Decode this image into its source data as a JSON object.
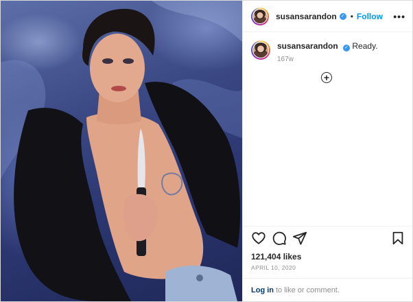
{
  "post": {
    "username": "susansarandon",
    "separator": "•",
    "follow_label": "Follow",
    "more_label": "•••",
    "caption": "Ready.",
    "caption_age": "167w",
    "likes": "121,404 likes",
    "date": "APRIL 10, 2020",
    "login_link": "Log in",
    "login_text": "to like or comment."
  },
  "icons": [
    "heart-icon",
    "comment-icon",
    "share-icon",
    "bookmark-icon",
    "add-circle-icon",
    "verified-icon",
    "more-options-icon"
  ],
  "colors": {
    "accent": "#0095f6",
    "verified": "#3897f0",
    "muted": "#8e8e8e"
  }
}
